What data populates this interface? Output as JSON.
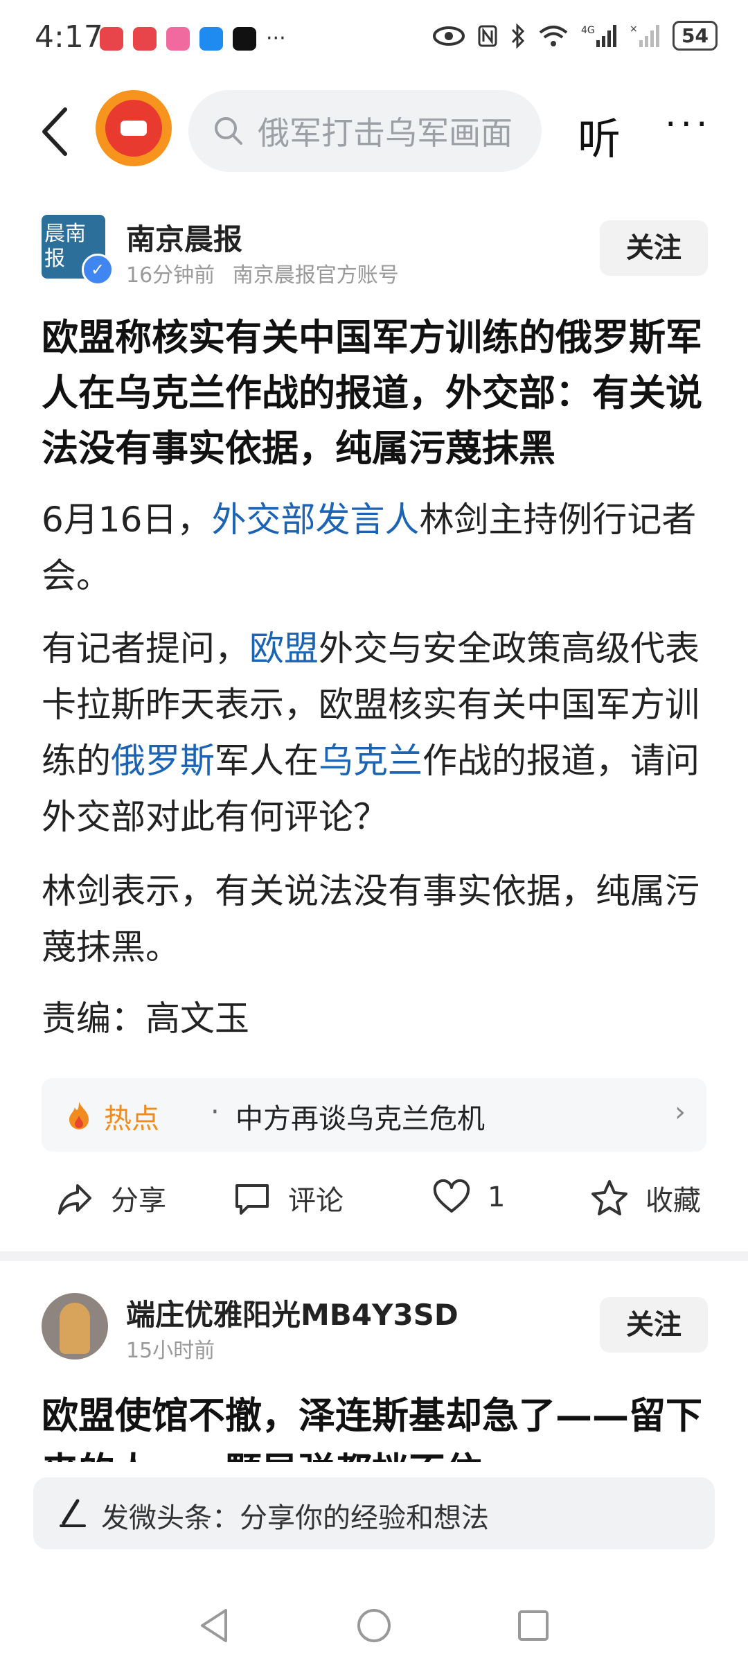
{
  "status_bar": {
    "time": "4:17",
    "more": "···",
    "battery": "54"
  },
  "top_nav": {
    "search_placeholder": "俄军打击乌军画面",
    "listen_label": "听",
    "more_label": "···"
  },
  "article": {
    "author_name": "南京晨报",
    "author_avatar_text": "晨南报",
    "time_ago": "16分钟前",
    "account_desc": "南京晨报官方账号",
    "follow_label": "关注",
    "title": "欧盟称核实有关中国军方训练的俄罗斯军人在乌克兰作战的报道，外交部：有关说法没有事实依据，纯属污蔑抹黑",
    "p1_a": "6月16日，",
    "p1_link": "外交部发言人",
    "p1_b": "林剑主持例行记者会。",
    "p2_a": "有记者提问，",
    "p2_link1": "欧盟",
    "p2_b": "外交与安全政策高级代表卡拉斯昨天表示，欧盟核实有关中国军方训练的",
    "p2_link2": "俄罗斯",
    "p2_c": "军人在",
    "p2_link3": "乌克兰",
    "p2_d": "作战的报道，请问外交部对此有何评论？",
    "p3": "林剑表示，有关说法没有事实依据，纯属污蔑抹黑。",
    "editor": "责编：高文玉"
  },
  "hot_topic": {
    "label": "热点",
    "dot": "·",
    "text": "中方再谈乌克兰危机",
    "chevron": "›"
  },
  "actions": {
    "share": "分享",
    "comment": "评论",
    "like_count": "1",
    "favorite": "收藏"
  },
  "second_post": {
    "author_name": "端庄优雅阳光MB4Y3SD",
    "time_ago": "15小时前",
    "follow_label": "关注",
    "title": "欧盟使馆不撤，泽连斯基却急了——留下来的人，一颗导弹都挡不住"
  },
  "composer": {
    "placeholder": "发微头条：分享你的经验和想法"
  },
  "colors": {
    "link": "#1b63b5",
    "hot": "#f28b1e",
    "app_logo_outer": "#f7941d",
    "app_logo_inner": "#e83a2e",
    "verify_badge": "#3f86f1"
  }
}
